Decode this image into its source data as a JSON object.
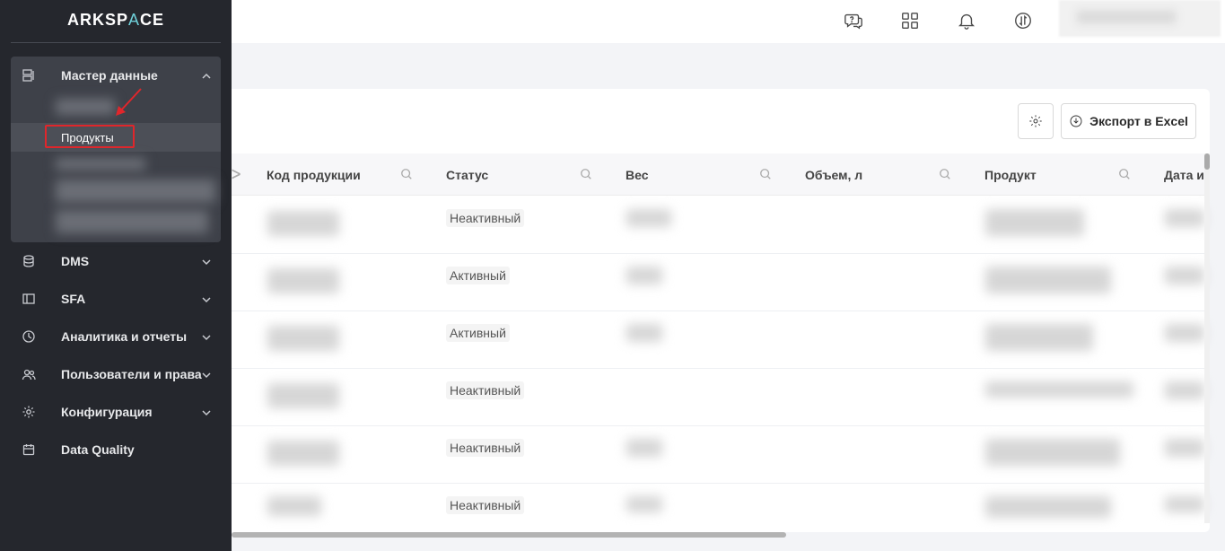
{
  "brand": {
    "logo_main": "ARKSP",
    "logo_accent": "A",
    "logo_tail": "CE"
  },
  "sidebar": {
    "groups": [
      {
        "label": "Мастер данные",
        "icon": "master-data-icon",
        "expanded": true
      },
      {
        "label": "DMS",
        "icon": "database-icon"
      },
      {
        "label": "SFA",
        "icon": "layout-icon"
      },
      {
        "label": "Аналитика и отчеты",
        "icon": "clock-chart-icon"
      },
      {
        "label": "Пользователи и права",
        "icon": "users-icon"
      },
      {
        "label": "Конфигурация",
        "icon": "gear-icon"
      },
      {
        "label": "Data Quality",
        "icon": "calendar-icon"
      }
    ],
    "active_subitem": "Продукты"
  },
  "topbar": {
    "icons": [
      "support-chat-icon",
      "apps-grid-icon",
      "bell-icon",
      "sync-icon"
    ]
  },
  "toolbar": {
    "settings_icon": "gear-icon",
    "export_label": "Экспорт в Excel"
  },
  "table": {
    "columns": [
      "Код продукции",
      "Статус",
      "Вес",
      "Объем, л",
      "Продукт",
      "Дата и"
    ],
    "statuses": [
      "Неактивный",
      "Активный",
      "Активный",
      "Неактивный",
      "Неактивный",
      "Неактивный"
    ]
  },
  "colors": {
    "sidebar_bg": "#25272d",
    "accent": "#6fd0d9",
    "highlight": "#e0262b"
  }
}
